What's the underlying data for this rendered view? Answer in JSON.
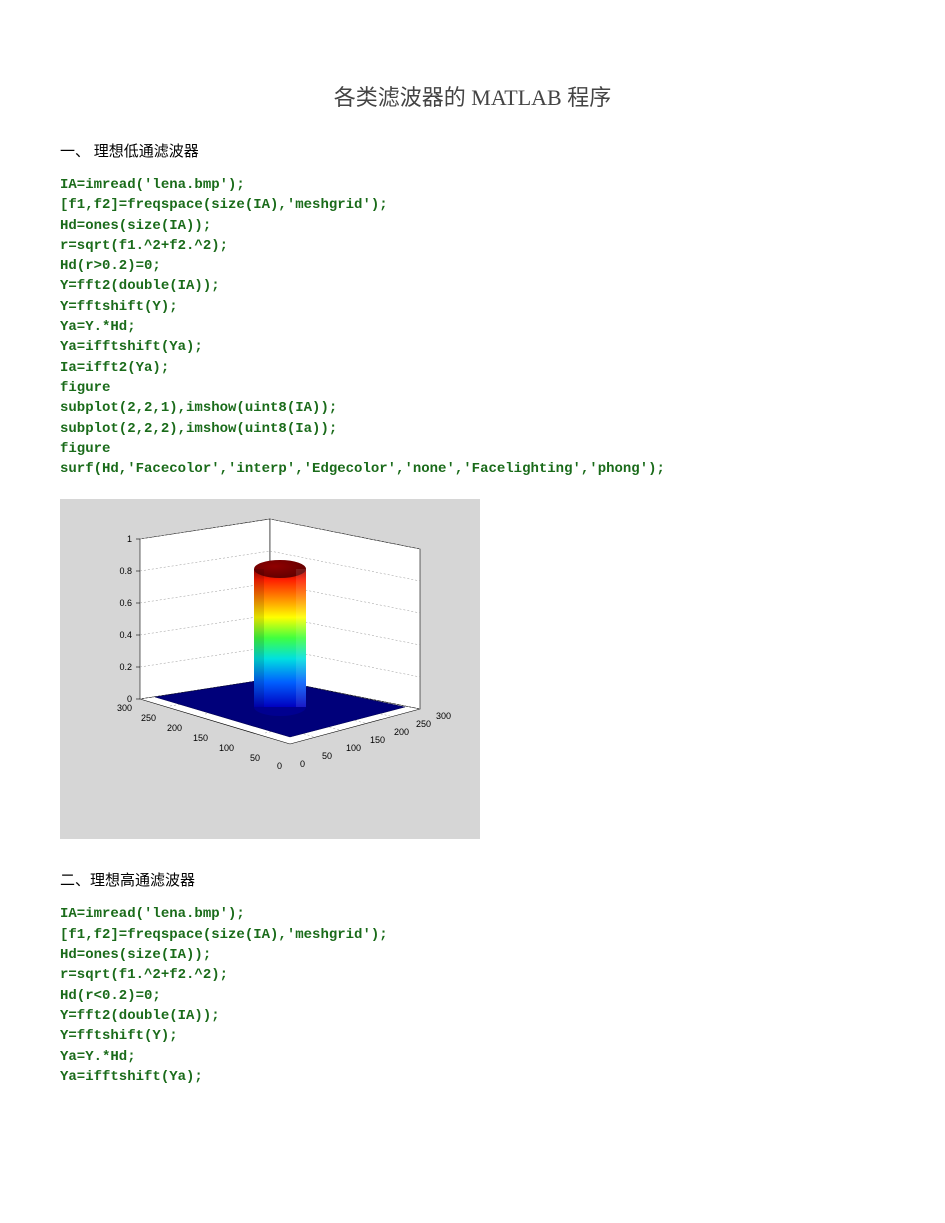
{
  "title": "各类滤波器的 MATLAB 程序",
  "section1": {
    "heading": "一、  理想低通滤波器",
    "code": "IA=imread('lena.bmp');\n[f1,f2]=freqspace(size(IA),'meshgrid');\nHd=ones(size(IA));\nr=sqrt(f1.^2+f2.^2);\nHd(r>0.2)=0;\nY=fft2(double(IA));\nY=fftshift(Y);\nYa=Y.*Hd;\nYa=ifftshift(Ya);\nIa=ifft2(Ya);\nfigure\nsubplot(2,2,1),imshow(uint8(IA));\nsubplot(2,2,2),imshow(uint8(Ia));\nfigure\nsurf(Hd,'Facecolor','interp','Edgecolor','none','Facelighting','phong');"
  },
  "section2": {
    "heading": "二、理想高通滤波器",
    "code": "IA=imread('lena.bmp');\n[f1,f2]=freqspace(size(IA),'meshgrid');\nHd=ones(size(IA));\nr=sqrt(f1.^2+f2.^2);\nHd(r<0.2)=0;\nY=fft2(double(IA));\nY=fftshift(Y);\nYa=Y.*Hd;\nYa=ifftshift(Ya);"
  },
  "chart_data": {
    "type": "surf",
    "title": "",
    "description": "3D surface of ideal low-pass filter Hd — cylinder of height 1 over a flat base of 0",
    "x_range": [
      0,
      300
    ],
    "y_range": [
      0,
      300
    ],
    "z_range": [
      0,
      1
    ],
    "x_ticks": [
      0,
      50,
      100,
      150,
      200,
      250,
      300
    ],
    "y_ticks": [
      0,
      50,
      100,
      150,
      200,
      250,
      300
    ],
    "z_ticks": [
      0,
      0.2,
      0.4,
      0.6,
      0.8,
      1
    ],
    "cylinder": {
      "center_x": 150,
      "center_y": 150,
      "radius": 30,
      "height": 1
    },
    "base_value": 0,
    "colormap": "jet"
  }
}
